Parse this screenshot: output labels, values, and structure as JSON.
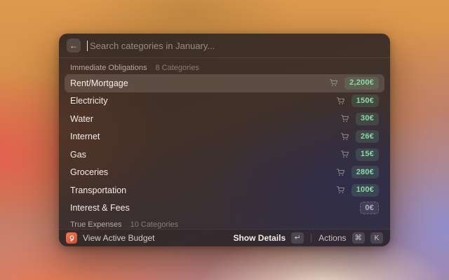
{
  "window": {
    "search": {
      "back_label": "←",
      "placeholder": "Search categories in January..."
    },
    "sections": [
      {
        "title": "Immediate Obligations",
        "count": "8 Categories",
        "items": [
          {
            "label": "Rent/Mortgage",
            "amount": "2,200€",
            "cart": true,
            "tone": "green",
            "selected": true
          },
          {
            "label": "Electricity",
            "amount": "150€",
            "cart": true,
            "tone": "green",
            "selected": false
          },
          {
            "label": "Water",
            "amount": "30€",
            "cart": true,
            "tone": "green",
            "selected": false
          },
          {
            "label": "Internet",
            "amount": "26€",
            "cart": true,
            "tone": "green",
            "selected": false
          },
          {
            "label": "Gas",
            "amount": "15€",
            "cart": true,
            "tone": "green",
            "selected": false
          },
          {
            "label": "Groceries",
            "amount": "280€",
            "cart": true,
            "tone": "green",
            "selected": false
          },
          {
            "label": "Transportation",
            "amount": "100€",
            "cart": true,
            "tone": "green",
            "selected": false
          },
          {
            "label": "Interest & Fees",
            "amount": "0€",
            "cart": false,
            "tone": "gray",
            "selected": false
          }
        ]
      },
      {
        "title": "True Expenses",
        "count": "10 Categories",
        "items": []
      }
    ],
    "footer": {
      "left_label": "View Active Budget",
      "primary_action": "Show Details",
      "primary_key": "↵",
      "secondary_action": "Actions",
      "secondary_keys": [
        "⌘",
        "K"
      ]
    },
    "colors": {
      "badge_green_text": "#89dba4",
      "badge_green_bg": "rgba(125,215,160,0.15)",
      "badge_gray_text": "#b7b1bb",
      "app_icon_accent": "#d8573c",
      "selection_bg": "rgba(255,245,236,0.14)"
    }
  }
}
